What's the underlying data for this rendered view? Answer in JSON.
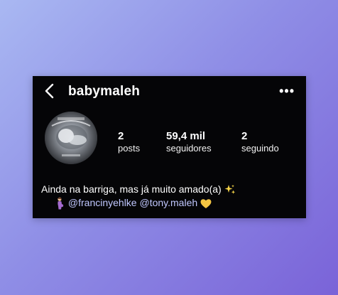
{
  "profile": {
    "username": "babymaleh",
    "stats": {
      "posts_count": "2",
      "posts_label": "posts",
      "followers_count": "59,4 mil",
      "followers_label": "seguidores",
      "following_count": "2",
      "following_label": "seguindo"
    },
    "bio": {
      "line1": "Ainda na barriga, mas já muito amado(a)",
      "mention1": "@francinyehlke",
      "mention2": "@tony.maleh"
    }
  },
  "icons": {
    "back": "chevron-left-icon",
    "more": "more-horizontal-icon",
    "sparkles": "sparkles-emoji",
    "pregnant": "pregnant-woman-emoji",
    "heart": "yellow-heart-emoji"
  },
  "colors": {
    "card_background": "#050507",
    "mention": "#c0c7ff",
    "heart": "#f5c542",
    "sparkle": "#f7d548",
    "background_start": "#a9b8f2",
    "background_end": "#7a63d8"
  }
}
